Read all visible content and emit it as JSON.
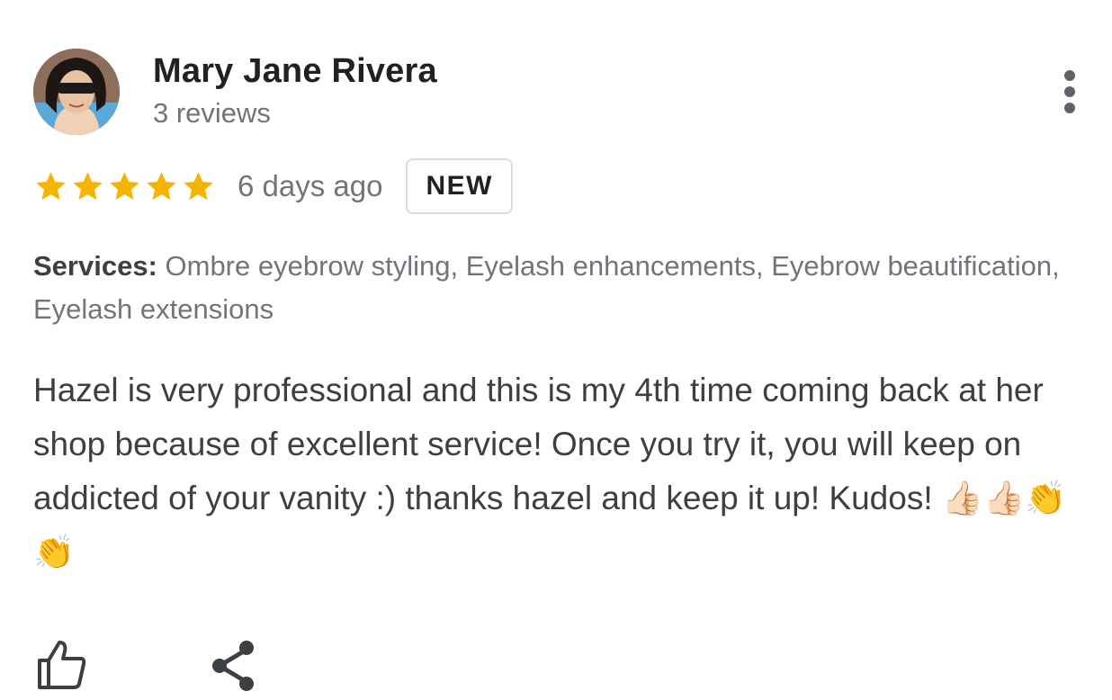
{
  "author": {
    "name": "Mary Jane Rivera",
    "review_count": "3 reviews",
    "avatar_icon": "profile-photo"
  },
  "menu": {
    "icon": "more-vert-icon"
  },
  "review": {
    "rating": 5,
    "rating_max": 5,
    "star_color": "#f4b400",
    "date": "6 days ago",
    "badge": "NEW",
    "services_label": "Services:",
    "services_list": " Ombre eyebrow styling, Eyelash enhancements, Eyebrow beautification, Eyelash extensions",
    "text": "Hazel is very professional and this is my 4th time coming back at her shop because of excellent service! Once you try it, you will keep on addicted of your vanity :) thanks hazel and keep it up! Kudos! 👍🏻👍🏻👏👏"
  },
  "actions": {
    "like_icon": "thumbs-up-icon",
    "share_icon": "share-icon"
  }
}
